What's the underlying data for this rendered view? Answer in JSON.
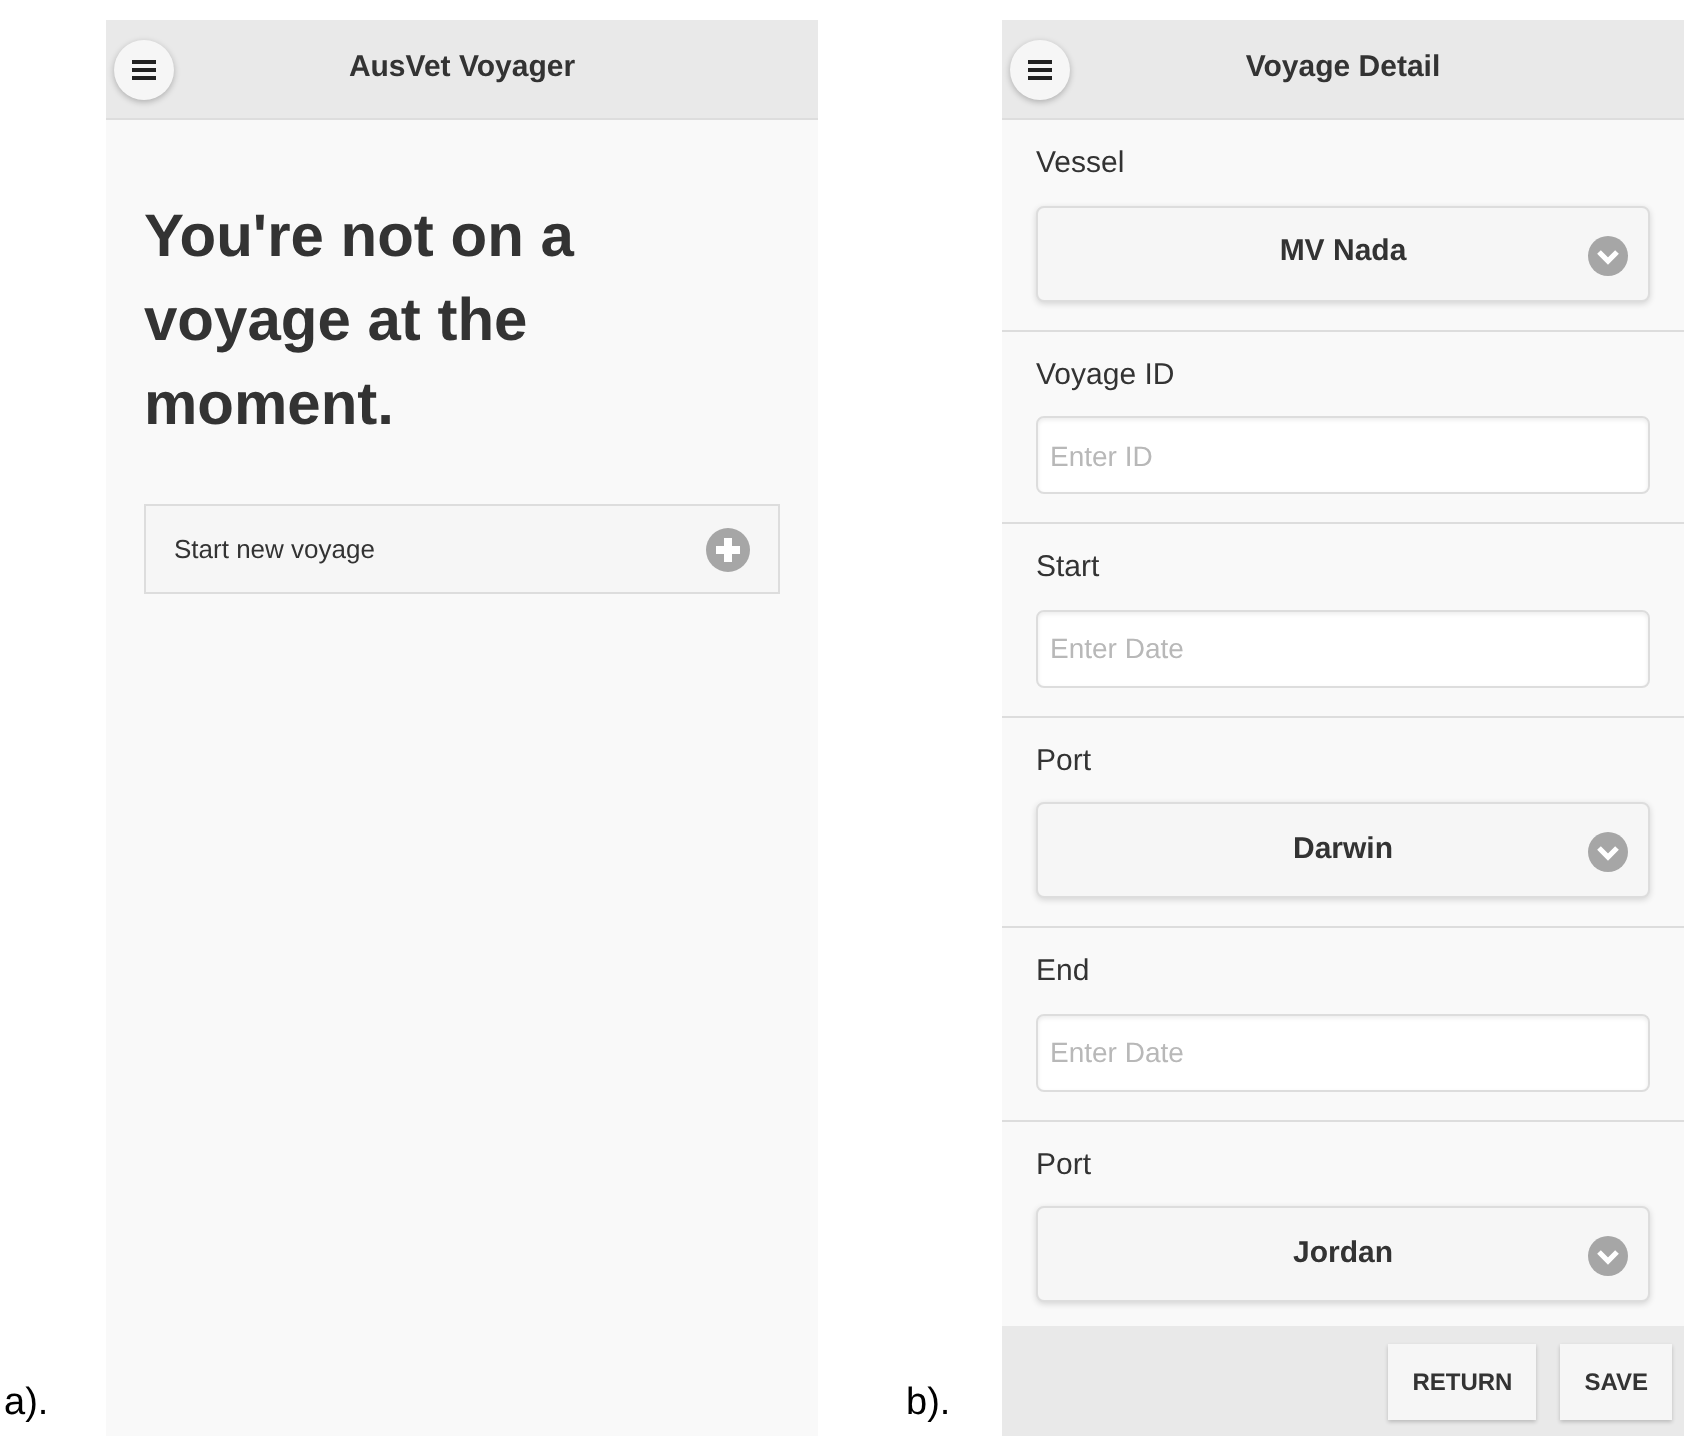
{
  "panels": [
    {
      "label": "a).",
      "kind": "home",
      "header": {
        "title": "AusVet Voyager"
      },
      "heading": "You're not on a voyage at the moment.",
      "action": {
        "label": "Start new voyage"
      }
    },
    {
      "label": "b).",
      "kind": "form",
      "header": {
        "title": "Voyage Detail"
      },
      "fields": [
        {
          "label": "Vessel",
          "kind": "select",
          "value": "MV Nada"
        },
        {
          "label": "Voyage ID",
          "kind": "input",
          "placeholder": "Enter ID"
        },
        {
          "label": "Start",
          "kind": "input",
          "placeholder": "Enter Date"
        },
        {
          "label": "Port",
          "kind": "select",
          "value": "Darwin"
        },
        {
          "label": "End",
          "kind": "input",
          "placeholder": "Enter Date"
        },
        {
          "label": "Port",
          "kind": "select",
          "value": "Jordan"
        }
      ],
      "footer": {
        "buttons": [
          "RETURN",
          "SAVE"
        ]
      }
    }
  ]
}
